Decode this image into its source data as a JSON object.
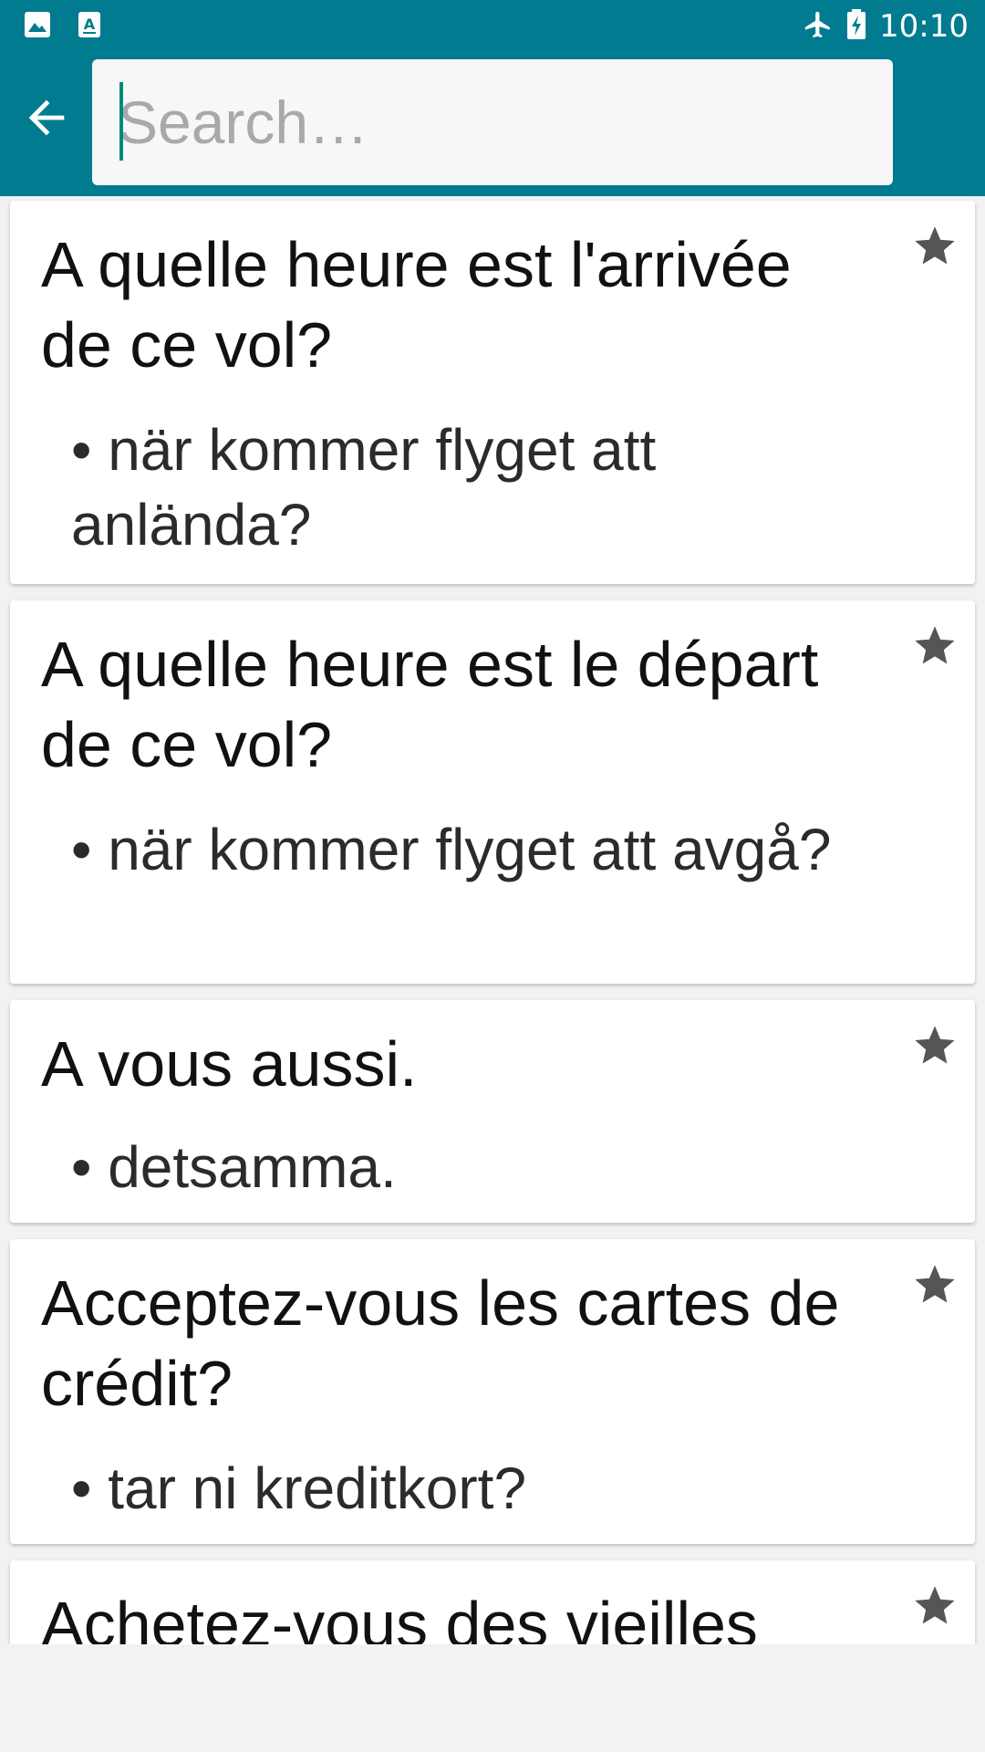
{
  "status_bar": {
    "time": "10:10",
    "icons": [
      "image-icon",
      "app-notification-icon",
      "airplane-mode-icon",
      "battery-charging-icon"
    ]
  },
  "app_bar": {
    "back_icon": "arrow-left-icon",
    "search": {
      "placeholder": "Search…",
      "value": ""
    }
  },
  "colors": {
    "primary": "#007b8f",
    "accent": "#00897b",
    "star": "#555555"
  },
  "phrases": [
    {
      "phrase": "A quelle heure est l'arrivée de ce vol?",
      "translation": "• när kommer flyget att anlända?",
      "favorite_icon": "star-icon"
    },
    {
      "phrase": "A quelle heure est le départ de ce vol?",
      "translation": "• när kommer flyget att avgå?",
      "favorite_icon": "star-icon"
    },
    {
      "phrase": "A vous aussi.",
      "translation": "• detsamma.",
      "favorite_icon": "star-icon"
    },
    {
      "phrase": "Acceptez-vous les cartes de crédit?",
      "translation": "• tar ni kreditkort?",
      "favorite_icon": "star-icon"
    },
    {
      "phrase": "Achetez-vous des vieilles",
      "translation": "",
      "favorite_icon": "star-icon"
    }
  ]
}
